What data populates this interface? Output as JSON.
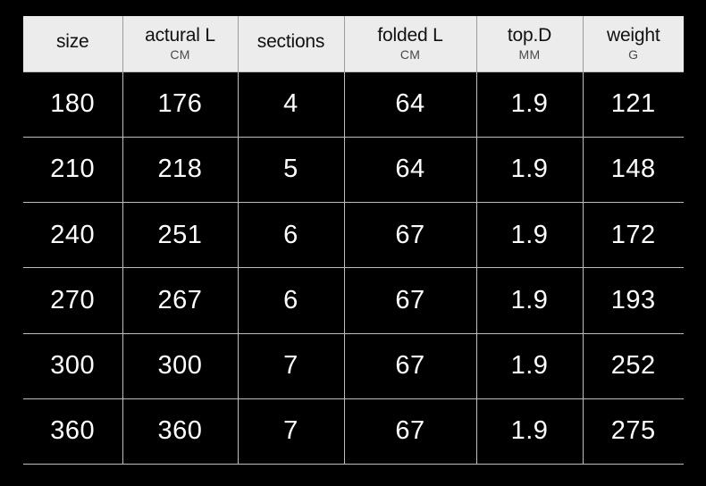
{
  "table": {
    "columns": [
      {
        "label": "size",
        "unit": ""
      },
      {
        "label": "actural L",
        "unit": "CM"
      },
      {
        "label": "sections",
        "unit": ""
      },
      {
        "label": "folded L",
        "unit": "CM"
      },
      {
        "label": "top.D",
        "unit": "MM"
      },
      {
        "label": "weight",
        "unit": "G"
      }
    ],
    "rows": [
      {
        "size": "180",
        "actural_l": "176",
        "sections": "4",
        "folded_l": "64",
        "top_d": "1.9",
        "weight": "121"
      },
      {
        "size": "210",
        "actural_l": "218",
        "sections": "5",
        "folded_l": "64",
        "top_d": "1.9",
        "weight": "148"
      },
      {
        "size": "240",
        "actural_l": "251",
        "sections": "6",
        "folded_l": "67",
        "top_d": "1.9",
        "weight": "172"
      },
      {
        "size": "270",
        "actural_l": "267",
        "sections": "6",
        "folded_l": "67",
        "top_d": "1.9",
        "weight": "193"
      },
      {
        "size": "300",
        "actural_l": "300",
        "sections": "7",
        "folded_l": "67",
        "top_d": "1.9",
        "weight": "252"
      },
      {
        "size": "360",
        "actural_l": "360",
        "sections": "7",
        "folded_l": "67",
        "top_d": "1.9",
        "weight": "275"
      }
    ]
  },
  "colors": {
    "page_background": "#000000",
    "header_background": "#ececed",
    "header_text": "#111111",
    "header_unit_text": "#4a4a4a",
    "cell_text": "#ffffff",
    "grid_line": "#bdbdbd",
    "header_divider": "#9a9a9a"
  }
}
